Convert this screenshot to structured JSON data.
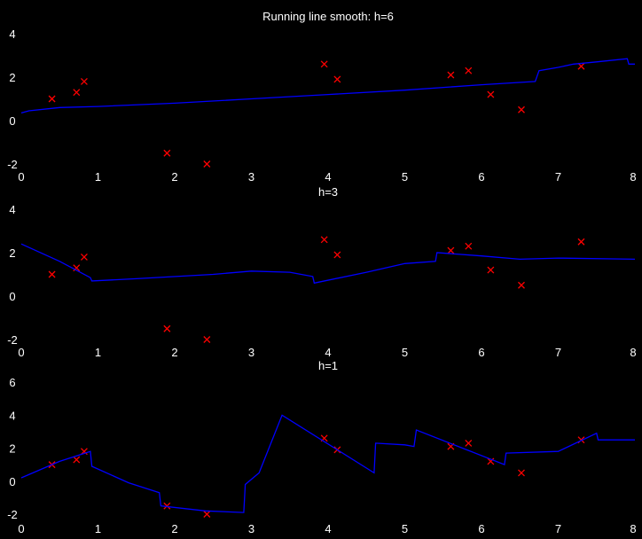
{
  "chart_data": [
    {
      "type": "line",
      "title": "Running line smooth: h=6",
      "xlabel": "",
      "ylabel": "",
      "xlim": [
        0,
        8
      ],
      "ylim": [
        -2,
        4
      ],
      "xticks": [
        0,
        1,
        2,
        3,
        4,
        5,
        6,
        7,
        8
      ],
      "yticks": [
        -2,
        0,
        2,
        4
      ],
      "grid": false,
      "series": [
        {
          "kind": "points",
          "color": "#ff0000",
          "marker": "x",
          "x": [
            0.4,
            0.72,
            0.82,
            1.9,
            2.42,
            3.95,
            4.12,
            5.6,
            5.83,
            6.12,
            6.52,
            7.3
          ],
          "y": [
            1.0,
            1.3,
            1.8,
            -1.5,
            -2.0,
            2.6,
            1.9,
            2.1,
            2.3,
            1.2,
            0.5,
            2.5
          ]
        },
        {
          "kind": "line",
          "color": "#0000ff",
          "x": [
            0.0,
            0.1,
            0.5,
            1.0,
            2.0,
            3.0,
            4.0,
            5.0,
            6.0,
            6.7,
            6.75,
            7.0,
            7.2,
            7.5,
            7.9,
            7.92,
            8.0
          ],
          "y": [
            0.35,
            0.45,
            0.6,
            0.65,
            0.8,
            1.0,
            1.2,
            1.4,
            1.65,
            1.8,
            2.3,
            2.45,
            2.6,
            2.7,
            2.85,
            2.6,
            2.6
          ]
        }
      ]
    },
    {
      "type": "line",
      "title": "h=3",
      "xlabel": "",
      "ylabel": "",
      "xlim": [
        0,
        8
      ],
      "ylim": [
        -2,
        4
      ],
      "xticks": [
        0,
        1,
        2,
        3,
        4,
        5,
        6,
        7,
        8
      ],
      "yticks": [
        -2,
        0,
        2,
        4
      ],
      "grid": false,
      "series": [
        {
          "kind": "points",
          "color": "#ff0000",
          "marker": "x",
          "x": [
            0.4,
            0.72,
            0.82,
            1.9,
            2.42,
            3.95,
            4.12,
            5.6,
            5.83,
            6.12,
            6.52,
            7.3
          ],
          "y": [
            1.0,
            1.3,
            1.8,
            -1.5,
            -2.0,
            2.6,
            1.9,
            2.1,
            2.3,
            1.2,
            0.5,
            2.5
          ]
        },
        {
          "kind": "line",
          "color": "#0000ff",
          "x": [
            0.0,
            0.5,
            0.9,
            0.92,
            1.5,
            2.5,
            3.0,
            3.5,
            3.8,
            3.82,
            4.5,
            5.0,
            5.4,
            5.42,
            6.0,
            6.5,
            7.0,
            8.0
          ],
          "y": [
            2.4,
            1.6,
            0.85,
            0.7,
            0.8,
            1.0,
            1.15,
            1.1,
            0.9,
            0.6,
            1.1,
            1.5,
            1.6,
            2.0,
            1.85,
            1.7,
            1.75,
            1.7
          ]
        }
      ]
    },
    {
      "type": "line",
      "title": "h=1",
      "xlabel": "",
      "ylabel": "",
      "xlim": [
        0,
        8
      ],
      "ylim": [
        -2,
        6
      ],
      "xticks": [
        0,
        1,
        2,
        3,
        4,
        5,
        6,
        7,
        8
      ],
      "yticks": [
        -2,
        0,
        2,
        4,
        6
      ],
      "grid": false,
      "series": [
        {
          "kind": "points",
          "color": "#ff0000",
          "marker": "x",
          "x": [
            0.4,
            0.72,
            0.82,
            1.9,
            2.42,
            3.95,
            4.12,
            5.6,
            5.83,
            6.12,
            6.52,
            7.3
          ],
          "y": [
            1.0,
            1.3,
            1.8,
            -1.5,
            -2.0,
            2.6,
            1.9,
            2.1,
            2.3,
            1.2,
            0.5,
            2.5
          ]
        },
        {
          "kind": "line",
          "color": "#0000ff",
          "x": [
            0.0,
            0.5,
            0.9,
            0.92,
            1.4,
            1.8,
            1.82,
            2.4,
            2.9,
            2.92,
            3.1,
            3.4,
            4.6,
            4.62,
            5.0,
            5.12,
            5.15,
            6.3,
            6.32,
            7.0,
            7.5,
            7.52,
            8.0
          ],
          "y": [
            0.2,
            1.2,
            1.8,
            0.9,
            -0.1,
            -0.7,
            -1.5,
            -1.8,
            -1.9,
            -0.2,
            0.5,
            4.0,
            0.5,
            2.3,
            2.2,
            2.1,
            3.1,
            1.0,
            1.7,
            1.8,
            2.9,
            2.5,
            2.5
          ]
        }
      ]
    }
  ]
}
